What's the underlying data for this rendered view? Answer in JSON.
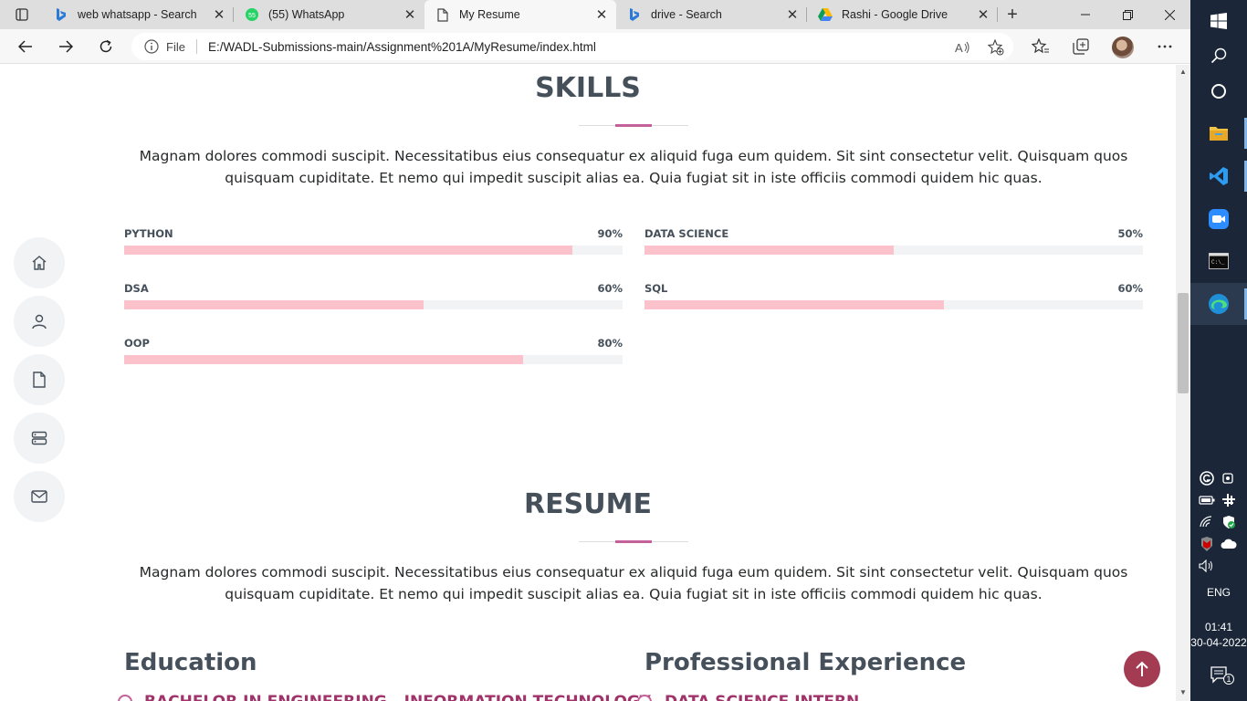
{
  "browser": {
    "tabs": [
      {
        "title": "web whatsapp - Search",
        "favicon": "bing-icon",
        "active": false
      },
      {
        "title": "(55) WhatsApp",
        "favicon": "whatsapp-icon",
        "active": false
      },
      {
        "title": "My Resume",
        "favicon": "file-page-icon",
        "active": true
      },
      {
        "title": "drive - Search",
        "favicon": "bing-icon",
        "active": false
      },
      {
        "title": "Rashi - Google Drive",
        "favicon": "google-drive-icon",
        "active": false
      }
    ],
    "address": {
      "scheme_label": "File",
      "url": "E:/WADL-Submissions-main/Assignment%201A/MyResume/index.html"
    }
  },
  "skills": {
    "title": "SKILLS",
    "description": "Magnam dolores commodi suscipit. Necessitatibus eius consequatur ex aliquid fuga eum quidem. Sit sint consectetur velit. Quisquam quos quisquam cupiditate. Et nemo qui impedit suscipit alias ea. Quia fugiat sit in iste officiis commodi quidem hic quas.",
    "items": [
      {
        "name": "PYTHON",
        "percent_label": "90%",
        "percent": 90
      },
      {
        "name": "DATA SCIENCE",
        "percent_label": "50%",
        "percent": 50
      },
      {
        "name": "DSA",
        "percent_label": "60%",
        "percent": 60
      },
      {
        "name": "SQL",
        "percent_label": "60%",
        "percent": 60
      },
      {
        "name": "OOP",
        "percent_label": "80%",
        "percent": 80
      }
    ]
  },
  "resume": {
    "title": "RESUME",
    "description": "Magnam dolores commodi suscipit. Necessitatibus eius consequatur ex aliquid fuga eum quidem. Sit sint consectetur velit. Quisquam quos quisquam cupiditate. Et nemo qui impedit suscipit alias ea. Quia fugiat sit in iste officiis commodi quidem hic quas.",
    "education_title": "Education",
    "education_first_item": "BACHELOR IN ENGINEERING - INFORMATION TECHNOLOGY",
    "experience_title": "Professional Experience",
    "experience_first_item": "DATA SCIENCE INTERN"
  },
  "side_nav": [
    "home-icon",
    "person-icon",
    "document-icon",
    "server-icon",
    "envelope-icon"
  ],
  "colors": {
    "accent": "#c4609a",
    "skill_fill": "#fbc2cc",
    "heading": "#45505b",
    "back_to_top": "#a33b52",
    "taskbar": "#1b2738"
  },
  "taskbar": {
    "language": "ENG",
    "time": "01:41",
    "date": "30-04-2022",
    "notification_count": "1"
  }
}
